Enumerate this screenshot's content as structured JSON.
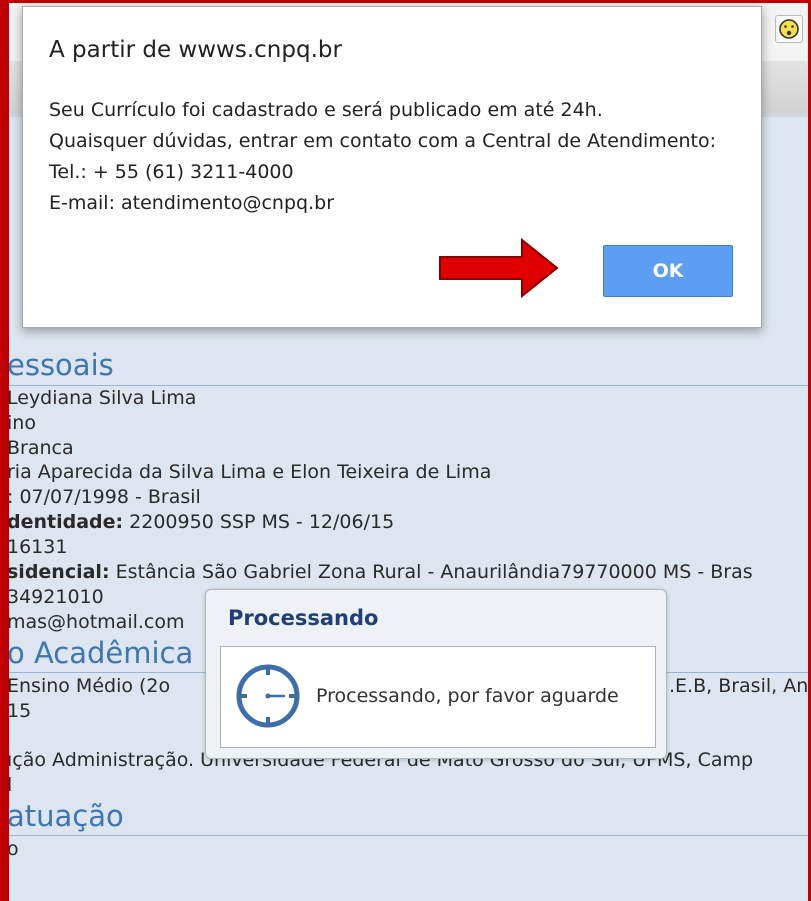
{
  "dialog": {
    "title": "A partir de wwws.cnpq.br",
    "message_lines": [
      "Seu Currículo foi cadastrado e será publicado em até 24h.",
      "Quaisquer dúvidas, entrar em contato com a Central de Atendimento:",
      "Tel.: + 55 (61) 3211-4000",
      "E-mail: atendimento@cnpq.br"
    ],
    "ok_label": "OK"
  },
  "processing": {
    "title": "Processando",
    "message": "Processando, por favor aguarde",
    "icon": "clock-icon"
  },
  "page": {
    "section_personal": "essoais",
    "name_line": "Leydiana Silva Lima",
    "sex_line": "ino",
    "race_line": "  Branca",
    "parents_line": "ria Aparecida da Silva Lima e Elon Teixeira de Lima",
    "birth_line": ":  07/07/1998 - Brasil",
    "id_label": "dentidade:",
    "id_value": " 2200950 SSP MS - 12/06/15",
    "cpf_line": "16131",
    "address_label": "sidencial:",
    "address_value": " Estância São Gabriel Zona Rural - Anaurilândia79770000 MS - Bras",
    "phone_line": "34921010",
    "email_line": "mas@hotmail.com",
    "section_academic": "o Acadêmica",
    "edu_line_1_left": " Ensino Médio (2o",
    "edu_line_1_right": ".E.B, Brasil, An",
    "edu_line_2": "15",
    "edu_line_3": "ıção Administração. Universidade Federal de Mato Grosso do Sul, UFMS, Camp",
    "edu_line_4": "l",
    "section_work": "atuação",
    "work_line": "o"
  },
  "toolbar": {
    "icon": "smiley-icon"
  },
  "colors": {
    "accent_red": "#c00000",
    "ok_blue": "#5c9ef4",
    "section_blue": "#3d76b2",
    "processing_title": "#1e3f7a"
  }
}
